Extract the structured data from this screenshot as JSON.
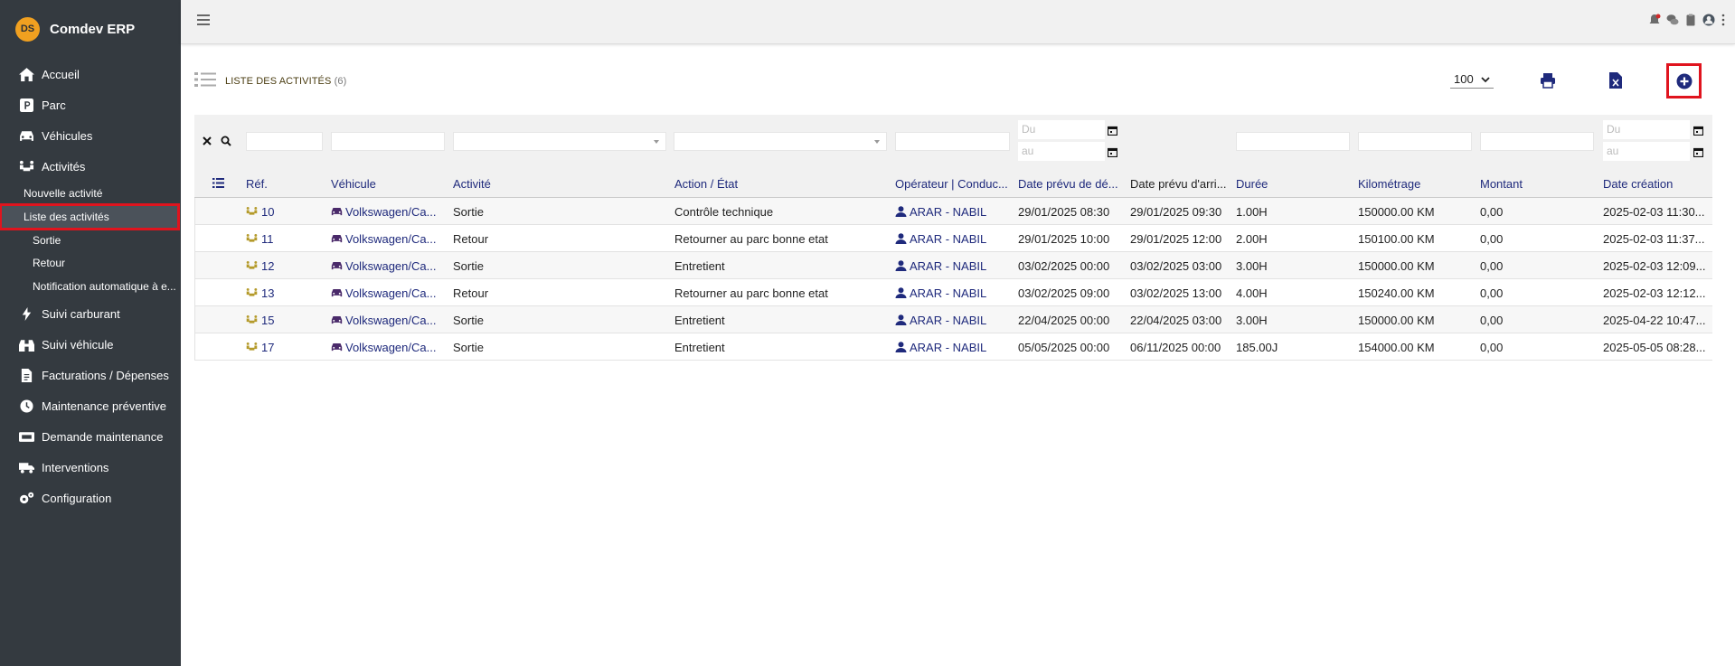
{
  "app": {
    "name": "Comdev ERP",
    "logo_text": "DS"
  },
  "colors": {
    "sidebar_bg": "#343a40",
    "accent": "#1f2a7c",
    "highlight": "#e0141e"
  },
  "sidebar": {
    "items": [
      {
        "label": "Accueil",
        "icon": "home-icon"
      },
      {
        "label": "Parc",
        "icon": "parking-icon"
      },
      {
        "label": "Véhicules",
        "icon": "car-icon"
      },
      {
        "label": "Activités",
        "icon": "people-car-icon"
      }
    ],
    "sub_items": [
      {
        "label": "Nouvelle activité"
      },
      {
        "label": "Liste des activités"
      },
      {
        "label": "Sortie"
      },
      {
        "label": "Retour"
      },
      {
        "label": "Notification automatique à e..."
      }
    ],
    "items_bottom": [
      {
        "label": "Suivi carburant",
        "icon": "bolt-icon"
      },
      {
        "label": "Suivi véhicule",
        "icon": "binoculars-icon"
      },
      {
        "label": "Facturations / Dépenses",
        "icon": "invoice-icon"
      },
      {
        "label": "Maintenance préventive",
        "icon": "clock-icon"
      },
      {
        "label": "Demande maintenance",
        "icon": "wrench-box-icon"
      },
      {
        "label": "Interventions",
        "icon": "truck-icon"
      },
      {
        "label": "Configuration",
        "icon": "gears-icon"
      }
    ]
  },
  "page": {
    "title": "LISTE DES ACTIVITÉS",
    "count": "(6)",
    "per_page": "100"
  },
  "filters": {
    "date_from_placeholder": "Du",
    "date_to_placeholder": "au"
  },
  "table": {
    "columns": [
      "Réf.",
      "Véhicule",
      "Activité",
      "Action / État",
      "Opérateur | Conduc...",
      "Date prévu de dé...",
      "Date prévu d'arri...",
      "Durée",
      "Kilométrage",
      "Montant",
      "Date création"
    ],
    "rows": [
      {
        "ref": "10",
        "vehicle": "Volkswagen/Ca...",
        "activity": "Sortie",
        "action": "Contrôle technique",
        "operator": "ARAR - NABIL",
        "date_dep": "29/01/2025 08:30",
        "date_arr": "29/01/2025 09:30",
        "duration": "1.00H",
        "km": "150000.00 KM",
        "amount": "0,00",
        "created": "2025-02-03 11:30..."
      },
      {
        "ref": "11",
        "vehicle": "Volkswagen/Ca...",
        "activity": "Retour",
        "action": "Retourner au parc bonne etat",
        "operator": "ARAR - NABIL",
        "date_dep": "29/01/2025 10:00",
        "date_arr": "29/01/2025 12:00",
        "duration": "2.00H",
        "km": "150100.00 KM",
        "amount": "0,00",
        "created": "2025-02-03 11:37..."
      },
      {
        "ref": "12",
        "vehicle": "Volkswagen/Ca...",
        "activity": "Sortie",
        "action": "Entretient",
        "operator": "ARAR - NABIL",
        "date_dep": "03/02/2025 00:00",
        "date_arr": "03/02/2025 03:00",
        "duration": "3.00H",
        "km": "150000.00 KM",
        "amount": "0,00",
        "created": "2025-02-03 12:09..."
      },
      {
        "ref": "13",
        "vehicle": "Volkswagen/Ca...",
        "activity": "Retour",
        "action": "Retourner au parc bonne etat",
        "operator": "ARAR - NABIL",
        "date_dep": "03/02/2025 09:00",
        "date_arr": "03/02/2025 13:00",
        "duration": "4.00H",
        "km": "150240.00 KM",
        "amount": "0,00",
        "created": "2025-02-03 12:12..."
      },
      {
        "ref": "15",
        "vehicle": "Volkswagen/Ca...",
        "activity": "Sortie",
        "action": "Entretient",
        "operator": "ARAR - NABIL",
        "date_dep": "22/04/2025 00:00",
        "date_arr": "22/04/2025 03:00",
        "duration": "3.00H",
        "km": "150000.00 KM",
        "amount": "0,00",
        "created": "2025-04-22 10:47..."
      },
      {
        "ref": "17",
        "vehicle": "Volkswagen/Ca...",
        "activity": "Sortie",
        "action": "Entretient",
        "operator": "ARAR - NABIL",
        "date_dep": "05/05/2025 00:00",
        "date_arr": "06/11/2025 00:00",
        "duration": "185.00J",
        "km": "154000.00 KM",
        "amount": "0,00",
        "created": "2025-05-05 08:28..."
      }
    ]
  }
}
